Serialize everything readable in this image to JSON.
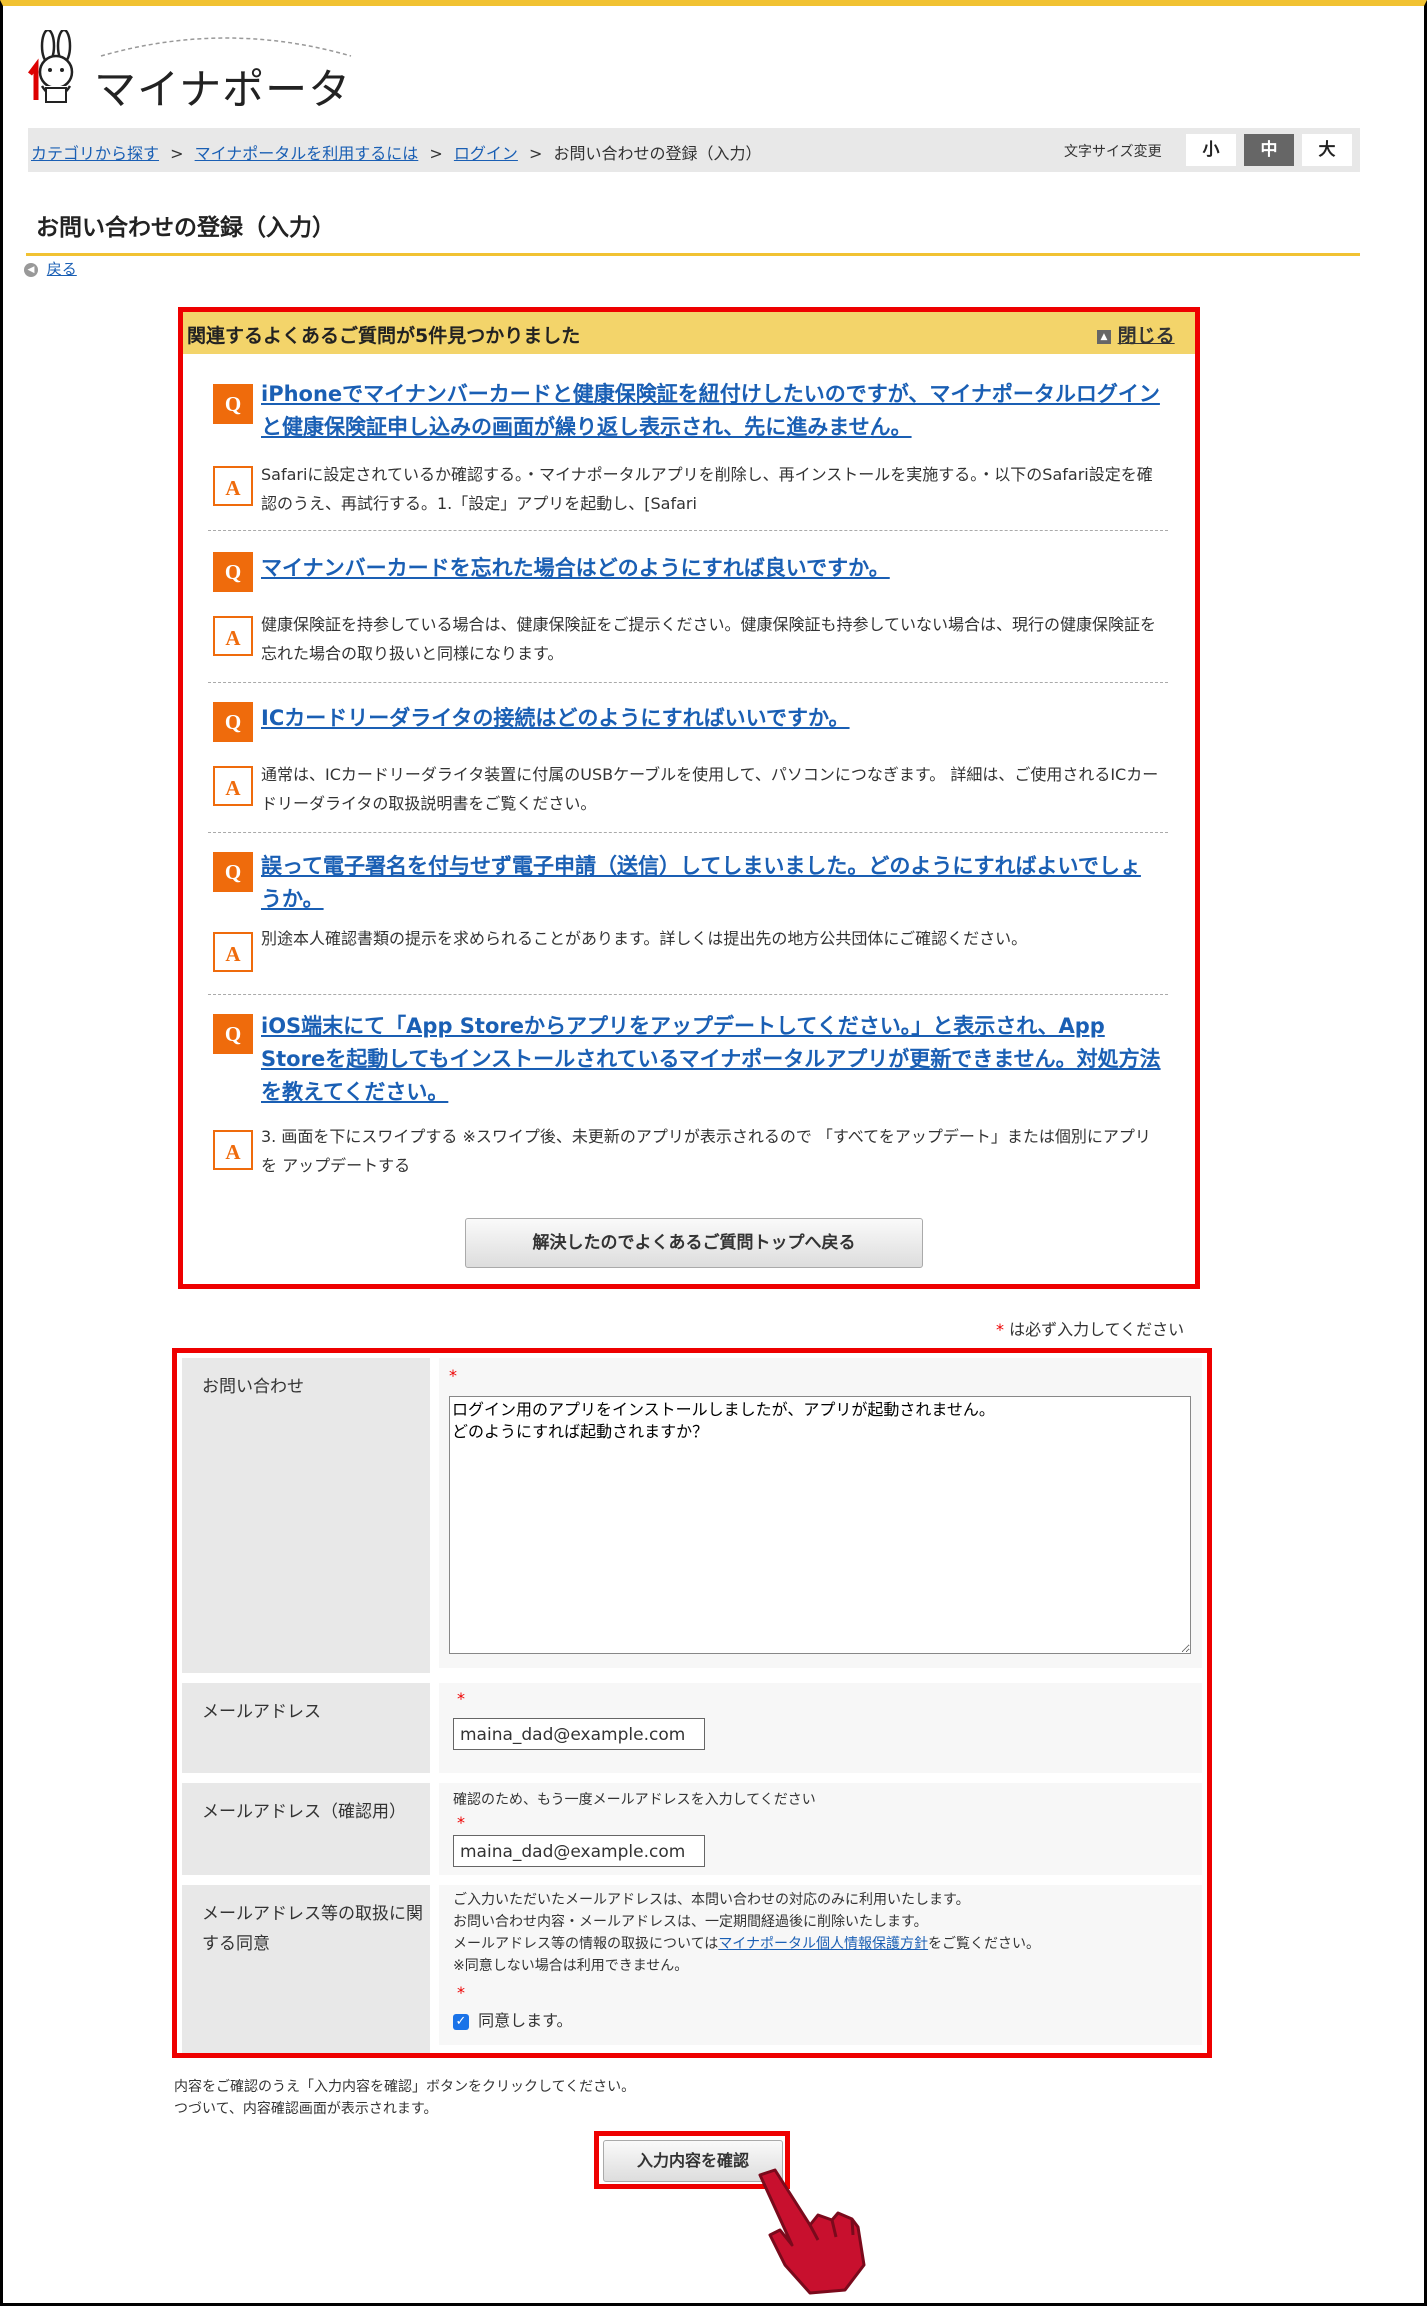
{
  "header": {
    "logo_text": "マイナポータル",
    "breadcrumb": [
      {
        "label": "カテゴリから探す"
      },
      {
        "label": "マイナポータルを利用するには"
      },
      {
        "label": "ログイン"
      },
      {
        "label": "お問い合わせの登録（入力）"
      }
    ],
    "separator": ">",
    "font_size_label": "文字サイズ変更",
    "font_sizes": [
      "小",
      "中",
      "大"
    ],
    "font_size_selected": "中"
  },
  "page": {
    "title": "お問い合わせの登録（入力）",
    "back_label": "戻る"
  },
  "faq": {
    "heading": "関連するよくあるご質問が5件見つかりました",
    "close_label": "閉じる",
    "q_badge": "Q",
    "a_badge": "A",
    "items": [
      {
        "q": "iPhoneでマイナンバーカードと健康保険証を紐付けしたいのですが、マイナポータルログインと健康保険証申し込みの画面が繰り返し表示され、先に進みません。",
        "a": "Safariに設定されているか確認する。・マイナポータルアプリを削除し、再インストールを実施する。・以下のSafari設定を確認のうえ、再試行する。1.「設定」アプリを起動し、[Safari"
      },
      {
        "q": "マイナンバーカードを忘れた場合はどのようにすれば良いですか。",
        "a": "健康保険証を持参している場合は、健康保険証をご提示ください。健康保険証も持参していない場合は、現行の健康保険証を忘れた場合の取り扱いと同様になります。"
      },
      {
        "q": "ICカードリーダライタの接続はどのようにすればいいですか。",
        "a": "通常は、ICカードリーダライタ装置に付属のUSBケーブルを使用して、パソコンにつなぎます。 詳細は、ご使用されるICカードリーダライタの取扱説明書をご覧ください。"
      },
      {
        "q": "誤って電子署名を付与せず電子申請（送信）してしまいました。どのようにすればよいでしょうか。",
        "a": "別途本人確認書類の提示を求められることがあります。詳しくは提出先の地方公共団体にご確認ください。"
      },
      {
        "q": "iOS端末にて「App Storeからアプリをアップデートしてください。」と表示され、App Storeを起動してもインストールされているマイナポータルアプリが更新できません。対処方法を教えてください。",
        "a": "3. 画面を下にスワイプする ※スワイプ後、未更新のアプリが表示されるので 「すべてをアップデート」または個別にアプリを アップデートする"
      }
    ],
    "resolved_button": "解決したのでよくあるご質問トップへ戻る"
  },
  "form": {
    "required_note_mark": "*",
    "required_note": "は必ず入力してください",
    "required_mark": "*",
    "inquiry_label": "お問い合わせ",
    "inquiry_value": "ログイン用のアプリをインストールしましたが、アプリが起動されません。\nどのようにすれば起動されますか？",
    "email_label": "メールアドレス",
    "email_value": "maina_dad@example.com",
    "email_confirm_label": "メールアドレス（確認用）",
    "email_confirm_note": "確認のため、もう一度メールアドレスを入力してください",
    "email_confirm_value": "maina_dad@example.com",
    "consent_label": "メールアドレス等の取扱に関する同意",
    "consent_line1": "ご入力いただいたメールアドレスは、本問い合わせの対応のみに利用いたします。",
    "consent_line2": "お問い合わせ内容・メールアドレスは、一定期間経過後に削除いたします。",
    "consent_line3_pre": "メールアドレス等の情報の取扱については",
    "consent_link": "マイナポータル個人情報保護方針",
    "consent_line3_post": "をご覧ください。",
    "consent_line4": "※同意しない場合は利用できません。",
    "agree_label": "同意します。",
    "agree_checked": true
  },
  "footer": {
    "instruction1": "内容をご確認のうえ「入力内容を確認」ボタンをクリックしてください。",
    "instruction2": "つづいて、内容確認画面が表示されます。",
    "confirm_button": "入力内容を確認"
  },
  "colors": {
    "accent": "#f1c232",
    "q_badge": "#ef6b0c",
    "highlight": "#ee0000",
    "link": "#1a5fb4"
  }
}
